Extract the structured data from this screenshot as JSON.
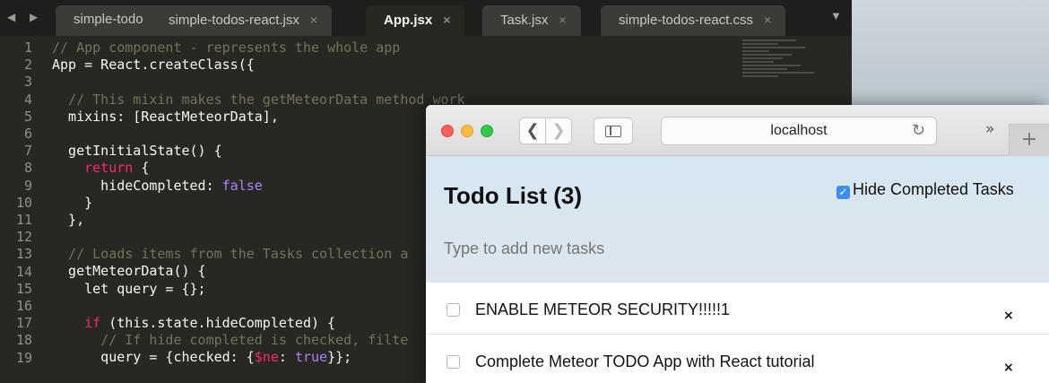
{
  "editor": {
    "tabs": [
      {
        "label": "simple-todo",
        "close": ""
      },
      {
        "label": "simple-todos-react.jsx",
        "close": "×"
      },
      {
        "label": "App.jsx",
        "close": "×"
      },
      {
        "label": "Task.jsx",
        "close": "×"
      },
      {
        "label": "simple-todos-react.css",
        "close": "×"
      }
    ],
    "nav_arrows": "◀ ▶",
    "overflow": "▼",
    "line_numbers": [
      "1",
      "2",
      "3",
      "4",
      "5",
      "6",
      "7",
      "8",
      "9",
      "10",
      "11",
      "12",
      "13",
      "14",
      "15",
      "16",
      "17",
      "18",
      "19"
    ],
    "code": [
      [
        {
          "t": "com",
          "v": "// App component - represents the whole app"
        }
      ],
      [
        {
          "t": "plain",
          "v": "App = React.createClass({"
        }
      ],
      [
        {
          "t": "plain",
          "v": ""
        }
      ],
      [
        {
          "t": "com",
          "v": "  // This mixin makes the getMeteorData method work"
        }
      ],
      [
        {
          "t": "plain",
          "v": "  mixins: [ReactMeteorData],"
        }
      ],
      [
        {
          "t": "plain",
          "v": ""
        }
      ],
      [
        {
          "t": "plain",
          "v": "  getInitialState() {"
        }
      ],
      [
        {
          "t": "key",
          "v": "    return"
        },
        {
          "t": "plain",
          "v": " {"
        }
      ],
      [
        {
          "t": "plain",
          "v": "      hideCompleted: "
        },
        {
          "t": "bool",
          "v": "false"
        }
      ],
      [
        {
          "t": "plain",
          "v": "    }"
        }
      ],
      [
        {
          "t": "plain",
          "v": "  },"
        }
      ],
      [
        {
          "t": "plain",
          "v": ""
        }
      ],
      [
        {
          "t": "com",
          "v": "  // Loads items from the Tasks collection a"
        }
      ],
      [
        {
          "t": "plain",
          "v": "  getMeteorData() {"
        }
      ],
      [
        {
          "t": "plain",
          "v": "    let query = {};"
        }
      ],
      [
        {
          "t": "plain",
          "v": ""
        }
      ],
      [
        {
          "t": "key",
          "v": "    if"
        },
        {
          "t": "plain",
          "v": " (this.state.hideCompleted) {"
        }
      ],
      [
        {
          "t": "com",
          "v": "      // If hide completed is checked, filte"
        }
      ],
      [
        {
          "t": "plain",
          "v": "      query = {checked: {"
        },
        {
          "t": "key",
          "v": "$ne"
        },
        {
          "t": "plain",
          "v": ": "
        },
        {
          "t": "bool",
          "v": "true"
        },
        {
          "t": "plain",
          "v": "}};"
        }
      ]
    ]
  },
  "browser": {
    "back_glyph": "❮",
    "forward_glyph": "❯",
    "address": "localhost",
    "reload_glyph": "↻",
    "more_glyph": "»",
    "new_tab_glyph": "+"
  },
  "app": {
    "title": "Todo List (3)",
    "hide_completed_label": "Hide Completed Tasks",
    "hide_completed_checked": true,
    "new_task_placeholder": "Type to add new tasks",
    "tasks": [
      {
        "text": "ENABLE METEOR SECURITY!!!!!1",
        "checked": false,
        "delete": "×"
      },
      {
        "text": "Complete Meteor TODO App with React tutorial",
        "checked": false,
        "delete": "×"
      }
    ]
  },
  "colors": {
    "editor_bg": "#272822",
    "comment": "#75715e",
    "keyword": "#f92672",
    "boolean": "#ae81ff",
    "header_bg": "#d5e7f1",
    "checkbox_accent": "#3b8df0"
  }
}
